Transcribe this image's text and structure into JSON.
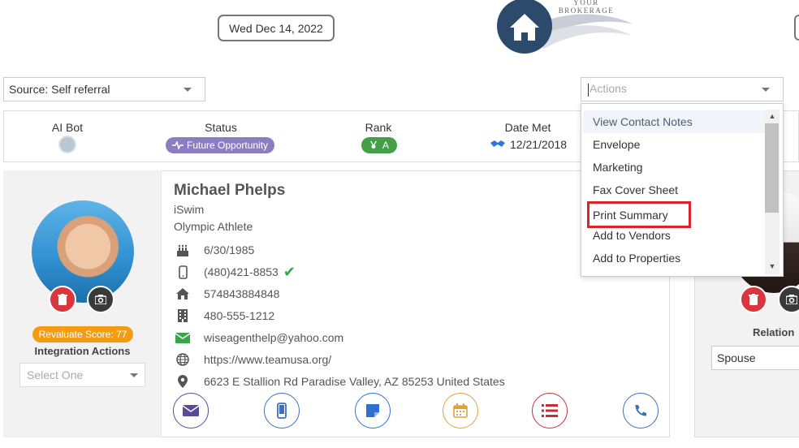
{
  "header": {
    "date": "Wed Dec 14, 2022",
    "logo_text": "YOUR BROKERAGE"
  },
  "source": {
    "value": "Source: Self referral"
  },
  "status_bar": {
    "ai_label": "AI Bot",
    "status_label": "Status",
    "status_value": "Future Opportunity",
    "rank_label": "Rank",
    "rank_value": "A",
    "date_met_label": "Date Met",
    "date_met_value": "12/21/2018"
  },
  "contact": {
    "name": "Michael Phelps",
    "company": "iSwim",
    "title": "Olympic Athlete",
    "birthday": "6/30/1985",
    "mobile": "(480)421-8853",
    "home": "574843884848",
    "office": "480-555-1212",
    "email": "wiseagenthelp@yahoo.com",
    "website": "https://www.teamusa.org/",
    "address": "6623 E Stallion Rd Paradise Valley, AZ 85253 United States",
    "revaluate": "Revaluate Score: 77",
    "integration_label": "Integration Actions",
    "integration_placeholder": "Select One"
  },
  "relation": {
    "label": "Relation",
    "value": "Spouse"
  },
  "actions": {
    "placeholder": "Actions",
    "items": [
      "View Contact Notes",
      "Envelope",
      "Marketing",
      "Fax Cover Sheet",
      "Print Summary",
      "Add to Vendors",
      "Add to Properties"
    ]
  },
  "colors": {
    "status_purple": "#8e7cc3",
    "rank_green": "#43a047",
    "revaluate_orange": "#f39c12",
    "delete_red": "#d9363e",
    "highlight_red": "#d9232d",
    "logo_navy": "#2c4a6b"
  }
}
